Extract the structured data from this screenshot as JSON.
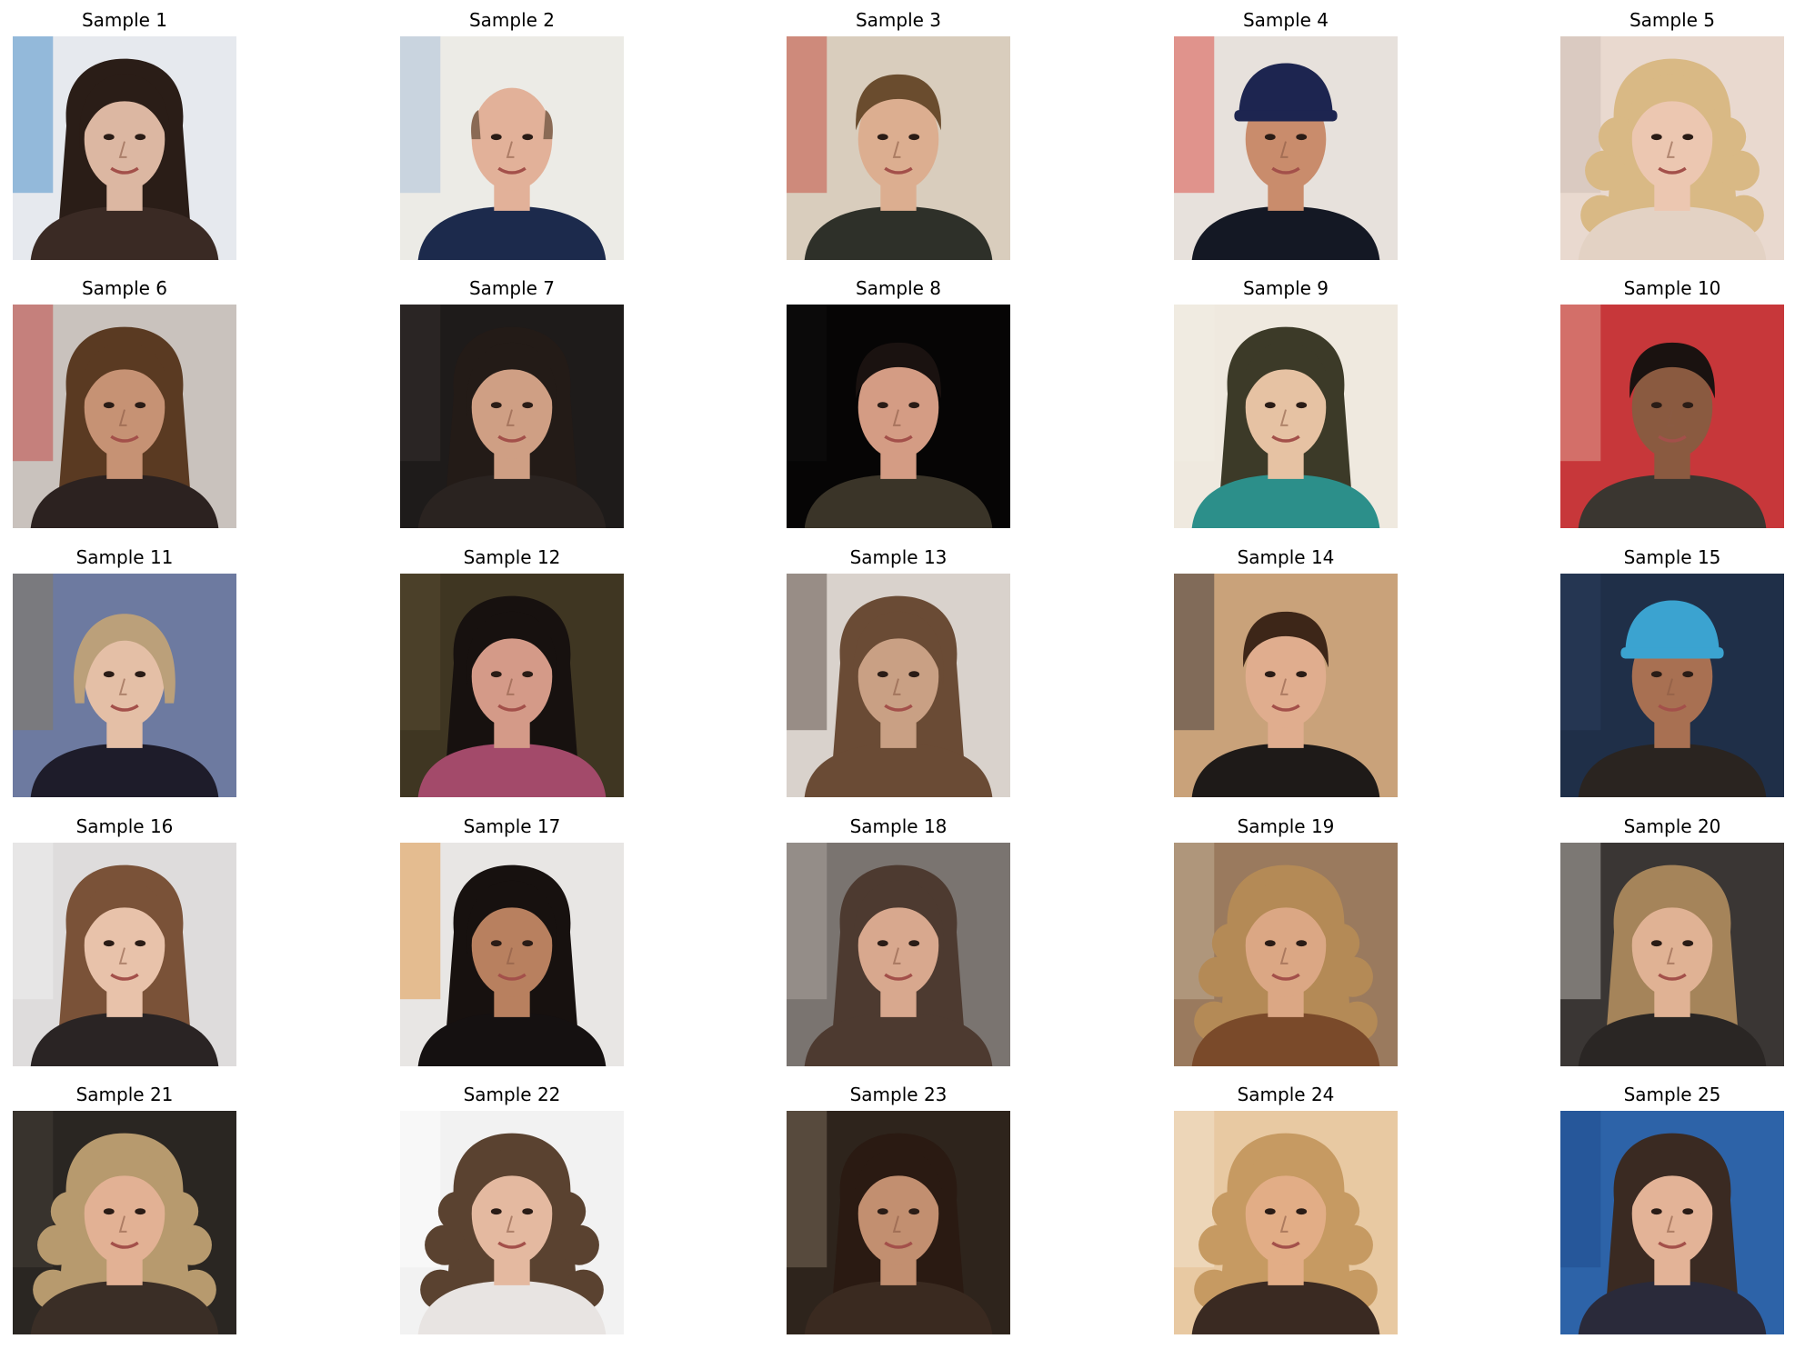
{
  "samples": [
    {
      "title": "Sample 1",
      "bg": "#e6e9ee",
      "skin": "#dcb7a2",
      "hair": "#2a1d17",
      "cloth": "#3a2a24",
      "hair_style": "long",
      "accent": "#2f7fc0"
    },
    {
      "title": "Sample 2",
      "bg": "#ecebe6",
      "skin": "#e2b199",
      "hair": "#8a6a55",
      "cloth": "#1c2a4c",
      "hair_style": "bald",
      "accent": "#9fb9d8"
    },
    {
      "title": "Sample 3",
      "bg": "#d9cdbd",
      "skin": "#dcae90",
      "hair": "#6a4c2e",
      "cloth": "#2e3029",
      "hair_style": "short",
      "accent": "#c0392b"
    },
    {
      "title": "Sample 4",
      "bg": "#e7e1dc",
      "skin": "#c98c6c",
      "hair": "#1d2550",
      "cloth": "#141824",
      "hair_style": "cap",
      "accent": "#d6352a"
    },
    {
      "title": "Sample 5",
      "bg": "#e9d9cf",
      "skin": "#ecc7b1",
      "hair": "#d9b985",
      "cloth": "#e3d2c4",
      "hair_style": "curly",
      "accent": "#c8b8b0"
    },
    {
      "title": "Sample 6",
      "bg": "#c9c2bd",
      "skin": "#c69274",
      "hair": "#5a3a22",
      "cloth": "#2c2220",
      "hair_style": "long",
      "accent": "#c0312c"
    },
    {
      "title": "Sample 7",
      "bg": "#1e1b1a",
      "skin": "#cf9f84",
      "hair": "#231b17",
      "cloth": "#2a2320",
      "hair_style": "long",
      "accent": "#3a3330"
    },
    {
      "title": "Sample 8",
      "bg": "#060505",
      "skin": "#d49c84",
      "hair": "#1a1210",
      "cloth": "#3a3428",
      "hair_style": "short",
      "accent": "#111111"
    },
    {
      "title": "Sample 9",
      "bg": "#efe9df",
      "skin": "#e6c2a3",
      "hair": "#3c3a28",
      "cloth": "#2c8f8a",
      "hair_style": "long",
      "accent": "#f2ede4"
    },
    {
      "title": "Sample 10",
      "bg": "#c7373a",
      "skin": "#8a5a40",
      "hair": "#1a1210",
      "cloth": "#3a3630",
      "hair_style": "short",
      "accent": "#e2b3a5"
    },
    {
      "title": "Sample 11",
      "bg": "#6d7aa0",
      "skin": "#e4bfa6",
      "hair": "#bba07a",
      "cloth": "#1e1c2a",
      "hair_style": "bob",
      "accent": "#8a7a55"
    },
    {
      "title": "Sample 12",
      "bg": "#3f3622",
      "skin": "#d49a88",
      "hair": "#17110f",
      "cloth": "#a34a6a",
      "hair_style": "long",
      "accent": "#5a4e33"
    },
    {
      "title": "Sample 13",
      "bg": "#d9d2cc",
      "skin": "#c9a084",
      "hair": "#6a4b35",
      "cloth": "#6a4b35",
      "hair_style": "long",
      "accent": "#4a3a30"
    },
    {
      "title": "Sample 14",
      "bg": "#c9a27a",
      "skin": "#e0ad8e",
      "hair": "#3d2618",
      "cloth": "#1e1a18",
      "hair_style": "short",
      "accent": "#2a2830"
    },
    {
      "title": "Sample 15",
      "bg": "#1f2f48",
      "skin": "#a87052",
      "hair": "#3ba3d0",
      "cloth": "#2a2420",
      "hair_style": "cap",
      "accent": "#2c4060"
    },
    {
      "title": "Sample 16",
      "bg": "#dedcdc",
      "skin": "#e8c2aa",
      "hair": "#7a5238",
      "cloth": "#2a2424",
      "hair_style": "long",
      "accent": "#f2f2f2"
    },
    {
      "title": "Sample 17",
      "bg": "#e8e6e4",
      "skin": "#b8805f",
      "hair": "#17110f",
      "cloth": "#151111",
      "hair_style": "long",
      "accent": "#e08a2a"
    },
    {
      "title": "Sample 18",
      "bg": "#7a7470",
      "skin": "#d8a88e",
      "hair": "#4d3a30",
      "cloth": "#4d3a30",
      "hair_style": "long",
      "accent": "#b3aca6"
    },
    {
      "title": "Sample 19",
      "bg": "#9a7a5e",
      "skin": "#dba784",
      "hair": "#b48a56",
      "cloth": "#7a4a2a",
      "hair_style": "curly",
      "accent": "#c9b7a0"
    },
    {
      "title": "Sample 20",
      "bg": "#3a3634",
      "skin": "#e0b294",
      "hair": "#a5845a",
      "cloth": "#2a2624",
      "hair_style": "long",
      "accent": "#cfcac4"
    },
    {
      "title": "Sample 21",
      "bg": "#2a2622",
      "skin": "#e2b194",
      "hair": "#b79a6e",
      "cloth": "#3a2e26",
      "hair_style": "curly",
      "accent": "#4a443c"
    },
    {
      "title": "Sample 22",
      "bg": "#f2f2f2",
      "skin": "#e4b9a0",
      "hair": "#5a4230",
      "cloth": "#e8e4e2",
      "hair_style": "curly",
      "accent": "#ffffff"
    },
    {
      "title": "Sample 23",
      "bg": "#2e241c",
      "skin": "#c28f70",
      "hair": "#2a1a12",
      "cloth": "#3a2a20",
      "hair_style": "long",
      "accent": "#8a7a66"
    },
    {
      "title": "Sample 24",
      "bg": "#e8c9a2",
      "skin": "#e2ad86",
      "hair": "#c69a62",
      "cloth": "#3a2a22",
      "hair_style": "curly",
      "accent": "#f4e6d2"
    },
    {
      "title": "Sample 25",
      "bg": "#2d63a8",
      "skin": "#e3b397",
      "hair": "#3a2a22",
      "cloth": "#2a2a3a",
      "hair_style": "long",
      "accent": "#1f4a8a"
    }
  ]
}
